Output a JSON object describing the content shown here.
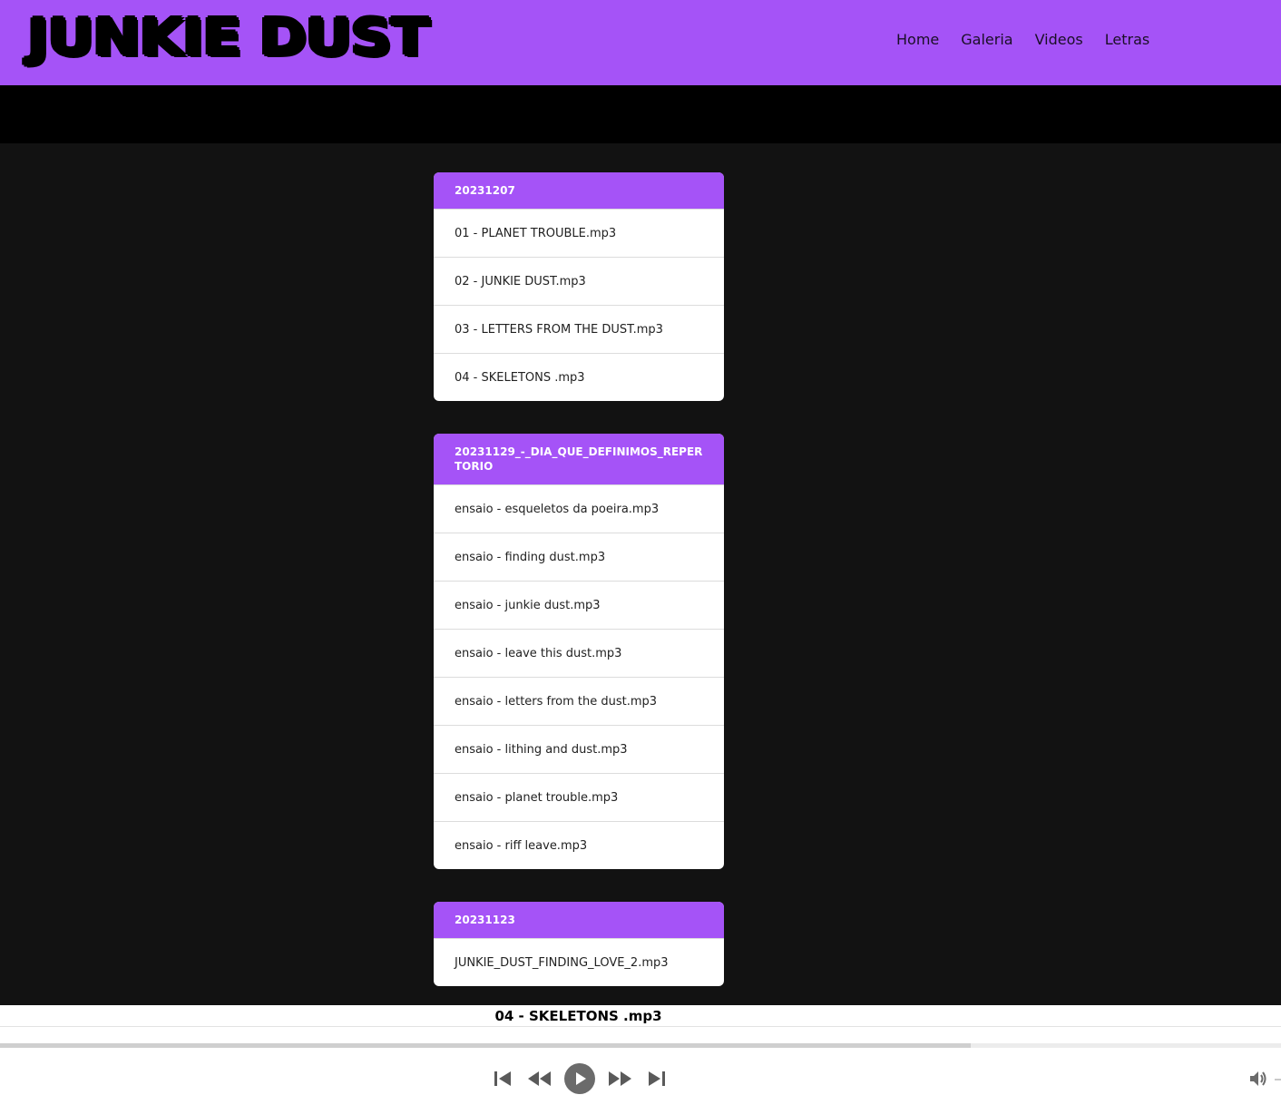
{
  "site": {
    "logo": "JUNKIE DUST",
    "nav": [
      "Home",
      "Galeria",
      "Videos",
      "Letras"
    ]
  },
  "albums": [
    {
      "title": "20231207",
      "tracks": [
        "01 - PLANET TROUBLE.mp3",
        "02 - JUNKIE DUST.mp3",
        "03 - LETTERS FROM THE DUST.mp3",
        "04 - SKELETONS .mp3"
      ]
    },
    {
      "title": "20231129_-_DIA_QUE_DEFINIMOS_REPERTORIO",
      "tracks": [
        "ensaio - esqueletos da poeira.mp3",
        "ensaio - finding dust.mp3",
        "ensaio - junkie dust.mp3",
        "ensaio - leave this dust.mp3",
        "ensaio - letters from the dust.mp3",
        "ensaio - lithing and dust.mp3",
        "ensaio - planet trouble.mp3",
        "ensaio - riff leave.mp3"
      ]
    },
    {
      "title": "20231123",
      "tracks": [
        "JUNKIE_DUST_FINDING_LOVE_2.mp3"
      ]
    }
  ],
  "player": {
    "now_playing": "04 - SKELETONS .mp3",
    "progress": 0.758,
    "controls": [
      "skip-back-icon",
      "rewind-icon",
      "play-icon",
      "fast-forward-icon",
      "skip-forward-icon"
    ],
    "volume_icon": "volume-icon"
  },
  "colors": {
    "accent": "#a553f7",
    "header_text": "#1a0f26",
    "background": "#121212",
    "band": "#000000",
    "card": "#ffffff"
  }
}
